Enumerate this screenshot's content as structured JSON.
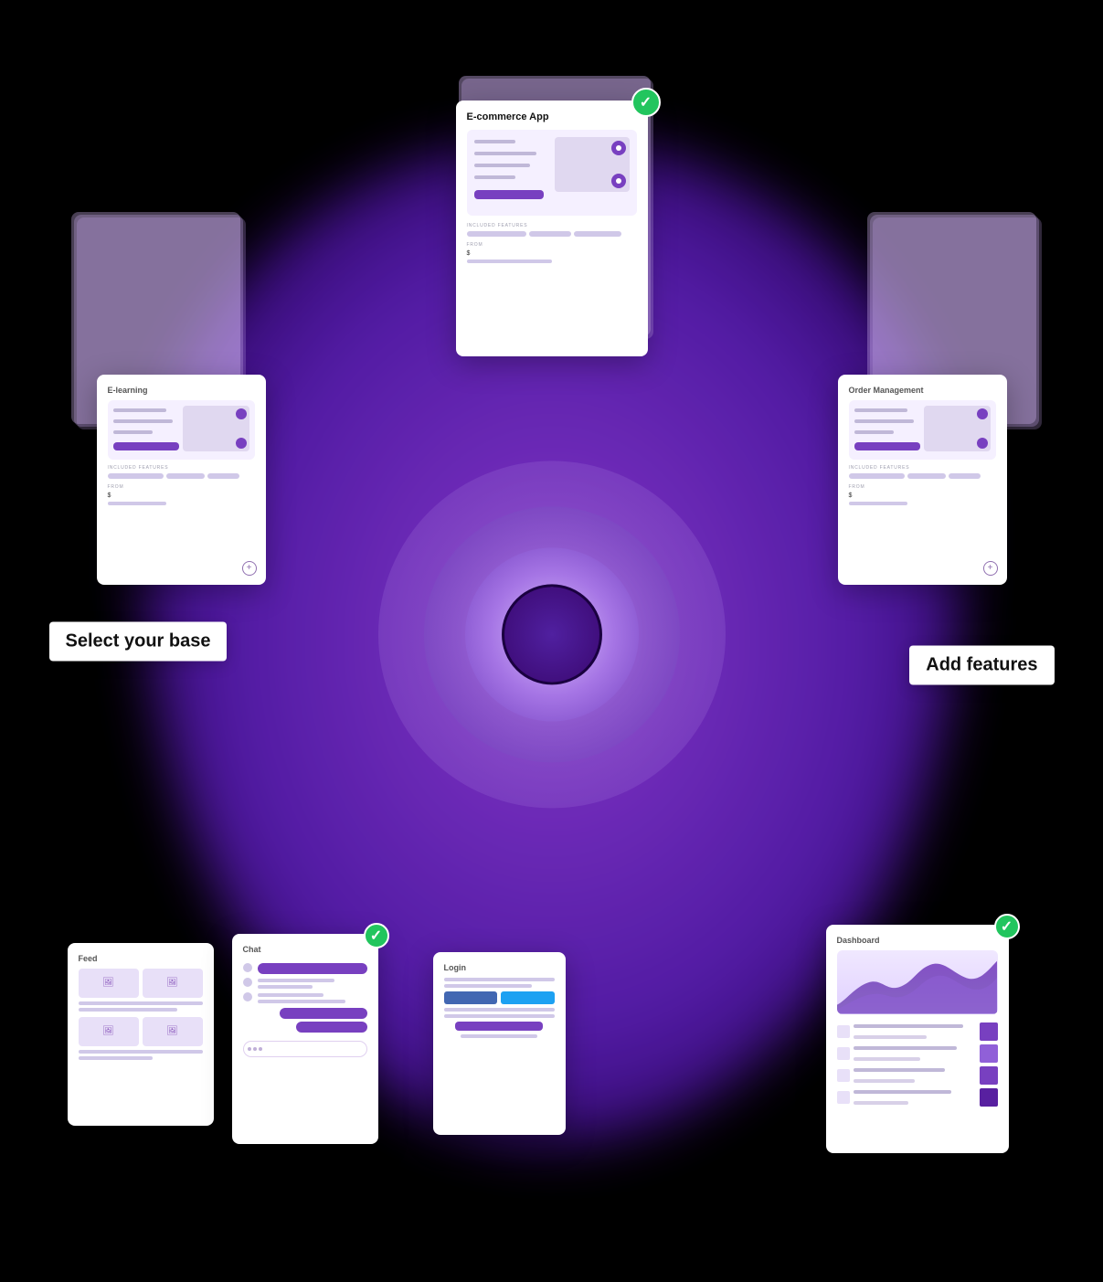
{
  "background": "#000000",
  "labels": {
    "select_base": "Select your base",
    "add_features": "Add features"
  },
  "cards": {
    "ecommerce": {
      "title": "E-commerce App",
      "checked": true,
      "from_label": "FROM",
      "from_price": "$",
      "included_features": "INCLUDED FEATURES"
    },
    "elearning": {
      "title": "E-learning",
      "from_label": "FROM",
      "from_price": "$"
    },
    "order_management": {
      "title": "Order Management",
      "from_label": "FROM",
      "from_price": "$"
    },
    "feed": {
      "title": "Feed"
    },
    "chat": {
      "title": "Chat",
      "checked": true
    },
    "login": {
      "title": "Login"
    },
    "dashboard": {
      "title": "Dashboard",
      "checked": true
    }
  },
  "icons": {
    "check": "✓",
    "plus": "+"
  },
  "colors": {
    "purple_main": "#7840c0",
    "purple_light": "#a070d8",
    "purple_blob": "#8a30e0",
    "green_check": "#22c55e",
    "white": "#ffffff",
    "card_bg": "#ffffff"
  }
}
